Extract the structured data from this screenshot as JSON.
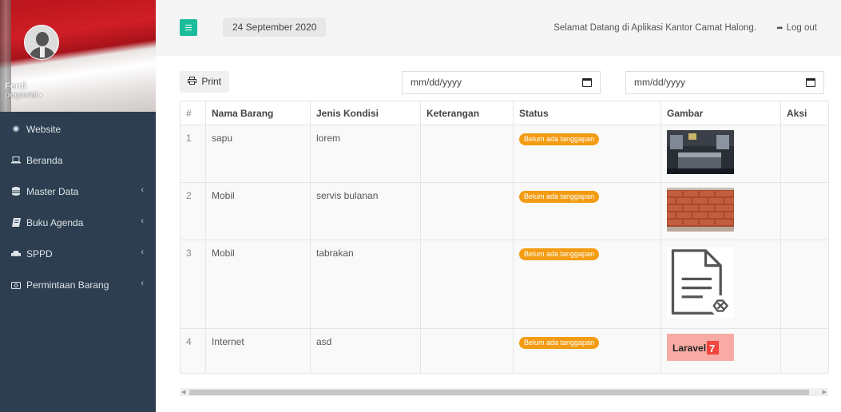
{
  "user": {
    "name": "Ferdi",
    "role": "pegawai"
  },
  "sidebar": {
    "items": [
      {
        "label": "Website",
        "icon": "globe-icon",
        "has_submenu": false
      },
      {
        "label": "Beranda",
        "icon": "laptop-icon",
        "has_submenu": false
      },
      {
        "label": "Master Data",
        "icon": "database-icon",
        "has_submenu": true
      },
      {
        "label": "Buku Agenda",
        "icon": "book-icon",
        "has_submenu": true
      },
      {
        "label": "SPPD",
        "icon": "car-icon",
        "has_submenu": true
      },
      {
        "label": "Permintaan Barang",
        "icon": "camera-icon",
        "has_submenu": true
      }
    ]
  },
  "topbar": {
    "date": "24 September 2020",
    "welcome": "Selamat Datang di Aplikasi Kantor Camat Halong.",
    "logout_label": "Log out"
  },
  "toolbar": {
    "print_label": "Print",
    "date_from_placeholder": "mm/dd/yyyy",
    "date_to_placeholder": "mm/dd/yyyy"
  },
  "table": {
    "headers": [
      "#",
      "Nama Barang",
      "Jenis Kondisi",
      "Keterangan",
      "Status",
      "Gambar",
      "Aksi"
    ],
    "rows": [
      {
        "no": "1",
        "nama": "sapu",
        "kondisi": "lorem",
        "keterangan": "",
        "status": "Belum ada tanggapan",
        "gambar": "bedroom-photo",
        "aksi": ""
      },
      {
        "no": "2",
        "nama": "Mobil",
        "kondisi": "servis bulanan",
        "keterangan": "",
        "status": "Belum ada tanggapan",
        "gambar": "brick-wall-photo",
        "aksi": ""
      },
      {
        "no": "3",
        "nama": "Mobil",
        "kondisi": "tabrakan",
        "keterangan": "",
        "status": "Belum ada tanggapan",
        "gambar": "broken-file-icon",
        "aksi": ""
      },
      {
        "no": "4",
        "nama": "Internet",
        "kondisi": "asd",
        "keterangan": "",
        "status": "Belum ada tanggapan",
        "gambar": "laravel-7-logo",
        "aksi": ""
      }
    ]
  },
  "colors": {
    "sidebar_bg": "#2c3e50",
    "accent": "#1abc9c",
    "badge": "#f39c12",
    "flag_red": "#d01e26"
  }
}
